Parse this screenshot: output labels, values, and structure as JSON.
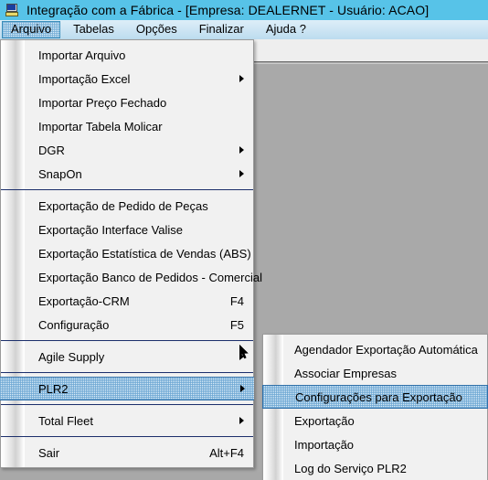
{
  "window": {
    "title": "Integração com a Fábrica - [Empresa: DEALERNET - Usuário: ACAO]",
    "icon": "computer-monitor-icon",
    "title_bar_color": "#57c3e8",
    "menu_bar_color": "#cfe6f4",
    "client_area_color": "#a9a9a9"
  },
  "menubar": {
    "items": [
      {
        "label": "Arquivo",
        "active": true
      },
      {
        "label": "Tabelas",
        "active": false
      },
      {
        "label": "Opções",
        "active": false
      },
      {
        "label": "Finalizar",
        "active": false
      },
      {
        "label": "Ajuda ?",
        "active": false
      }
    ]
  },
  "arquivo_menu": {
    "open": true,
    "items": [
      {
        "label": "Importar Arquivo",
        "shortcut": "",
        "submenu": false,
        "selected": false
      },
      {
        "label": "Importação Excel",
        "shortcut": "",
        "submenu": true,
        "selected": false
      },
      {
        "label": "Importar Preço Fechado",
        "shortcut": "",
        "submenu": false,
        "selected": false
      },
      {
        "label": "Importar Tabela Molicar",
        "shortcut": "",
        "submenu": false,
        "selected": false
      },
      {
        "label": "DGR",
        "shortcut": "",
        "submenu": true,
        "selected": false
      },
      {
        "label": "SnapOn",
        "shortcut": "",
        "submenu": true,
        "selected": false
      },
      {
        "separator": true
      },
      {
        "label": "Exportação de Pedido de Peças",
        "shortcut": "",
        "submenu": false,
        "selected": false
      },
      {
        "label": "Exportação Interface Valise",
        "shortcut": "",
        "submenu": false,
        "selected": false
      },
      {
        "label": "Exportação Estatística de Vendas (ABS)",
        "shortcut": "",
        "submenu": false,
        "selected": false
      },
      {
        "label": "Exportação Banco de Pedidos - Comercial",
        "shortcut": "",
        "submenu": false,
        "selected": false
      },
      {
        "label": "Exportação-CRM",
        "shortcut": "F4",
        "submenu": false,
        "selected": false
      },
      {
        "label": "Configuração",
        "shortcut": "F5",
        "submenu": false,
        "selected": false
      },
      {
        "separator": true
      },
      {
        "label": "Agile Supply",
        "shortcut": "",
        "submenu": true,
        "selected": false
      },
      {
        "separator": true
      },
      {
        "label": "PLR2",
        "shortcut": "",
        "submenu": true,
        "selected": true
      },
      {
        "separator": true
      },
      {
        "label": "Total Fleet",
        "shortcut": "",
        "submenu": true,
        "selected": false
      },
      {
        "separator": true
      },
      {
        "label": "Sair",
        "shortcut": "Alt+F4",
        "submenu": false,
        "selected": false
      }
    ]
  },
  "plr2_submenu": {
    "open": true,
    "items": [
      {
        "label": "Agendador Exportação Automática",
        "shortcut": "",
        "submenu": false,
        "selected": false
      },
      {
        "label": "Associar Empresas",
        "shortcut": "",
        "submenu": false,
        "selected": false
      },
      {
        "label": "Configurações para Exportação",
        "shortcut": "",
        "submenu": false,
        "selected": true
      },
      {
        "label": "Exportação",
        "shortcut": "",
        "submenu": false,
        "selected": false
      },
      {
        "label": "Importação",
        "shortcut": "",
        "submenu": false,
        "selected": false
      },
      {
        "label": "Log do Serviço PLR2",
        "shortcut": "",
        "submenu": false,
        "selected": false
      }
    ]
  },
  "colors": {
    "selection_border": "#2f6fa8",
    "separator": "#1c2f6b",
    "menu_background": "#f1f1f1"
  }
}
